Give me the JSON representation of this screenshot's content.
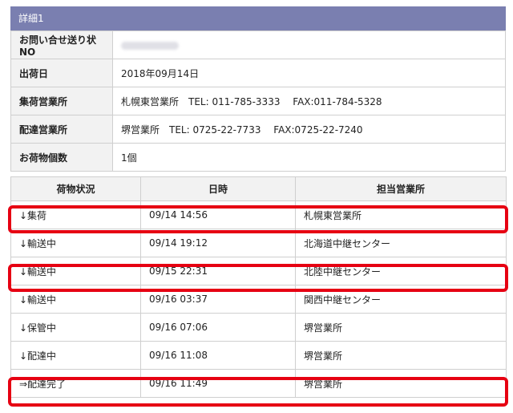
{
  "panel": {
    "title": "詳細1"
  },
  "info": [
    {
      "label": "お問い合せ送り状NO",
      "value": ""
    },
    {
      "label": "出荷日",
      "value": "2018年09月14日"
    },
    {
      "label": "集荷営業所",
      "value": "札幌東営業所　TEL: 011-785-3333　 FAX:011-784-5328"
    },
    {
      "label": "配達営業所",
      "value": "堺営業所　TEL: 0725-22-7733　 FAX:0725-22-7240"
    },
    {
      "label": "お荷物個数",
      "value": "1個"
    }
  ],
  "tracking": {
    "headers": [
      "荷物状況",
      "日時",
      "担当営業所"
    ],
    "rows": [
      {
        "status": "↓集荷",
        "datetime": "09/14 14:56",
        "office": "札幌東営業所"
      },
      {
        "status": "↓輸送中",
        "datetime": "09/14 19:12",
        "office": "北海道中継センター"
      },
      {
        "status": "↓輸送中",
        "datetime": "09/15 22:31",
        "office": "北陸中継センター"
      },
      {
        "status": "↓輸送中",
        "datetime": "09/16 03:37",
        "office": "関西中継センター"
      },
      {
        "status": "↓保管中",
        "datetime": "09/16 07:06",
        "office": "堺営業所"
      },
      {
        "status": "↓配達中",
        "datetime": "09/16 11:08",
        "office": "堺営業所"
      },
      {
        "status": "⇒配達完了",
        "datetime": "09/16 11:49",
        "office": "堺営業所"
      }
    ]
  },
  "highlight_color": "#e60012"
}
